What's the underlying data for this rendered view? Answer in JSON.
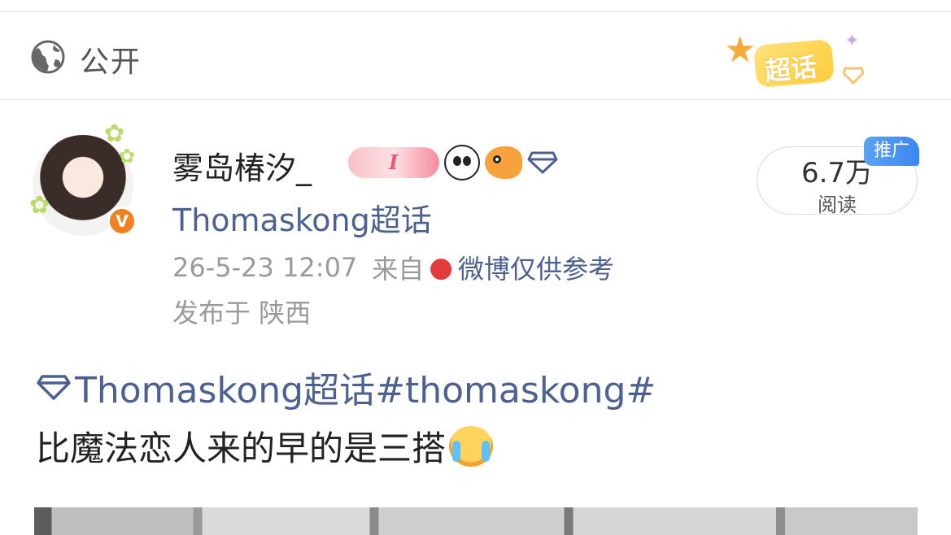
{
  "visibility": {
    "label": "公开",
    "icon": "globe-icon"
  },
  "supertopic_badge": {
    "label": "超话",
    "icon": "star-icon"
  },
  "post": {
    "author": {
      "name": "雾岛椿汐_",
      "avatar": "avatar",
      "verified_icon": "verified-badge-icon",
      "badges": [
        "pill-badge-icon",
        "panda-badge-icon",
        "fish-badge-icon",
        "diamond-badge-icon"
      ],
      "badge_letter": "I"
    },
    "supertopic": "Thomaskong超话",
    "timestamp": "26-5-23 12:07",
    "source_prefix": "来自",
    "source_icon": "strawberry-icon",
    "source": "微博仅供参考",
    "location": "发布于 陕西",
    "views": {
      "count": "6.7万",
      "label": "阅读"
    },
    "promo_tag": "推广",
    "topic_line": "Thomaskong超话#thomaskong#",
    "body": "比魔法恋人来的早的是三搭",
    "body_emoji": "crying-face-icon"
  },
  "colors": {
    "link": "#4d6190",
    "meta": "#9a9a9a",
    "promo": "#3d86ef",
    "verified": "#f1801f"
  }
}
